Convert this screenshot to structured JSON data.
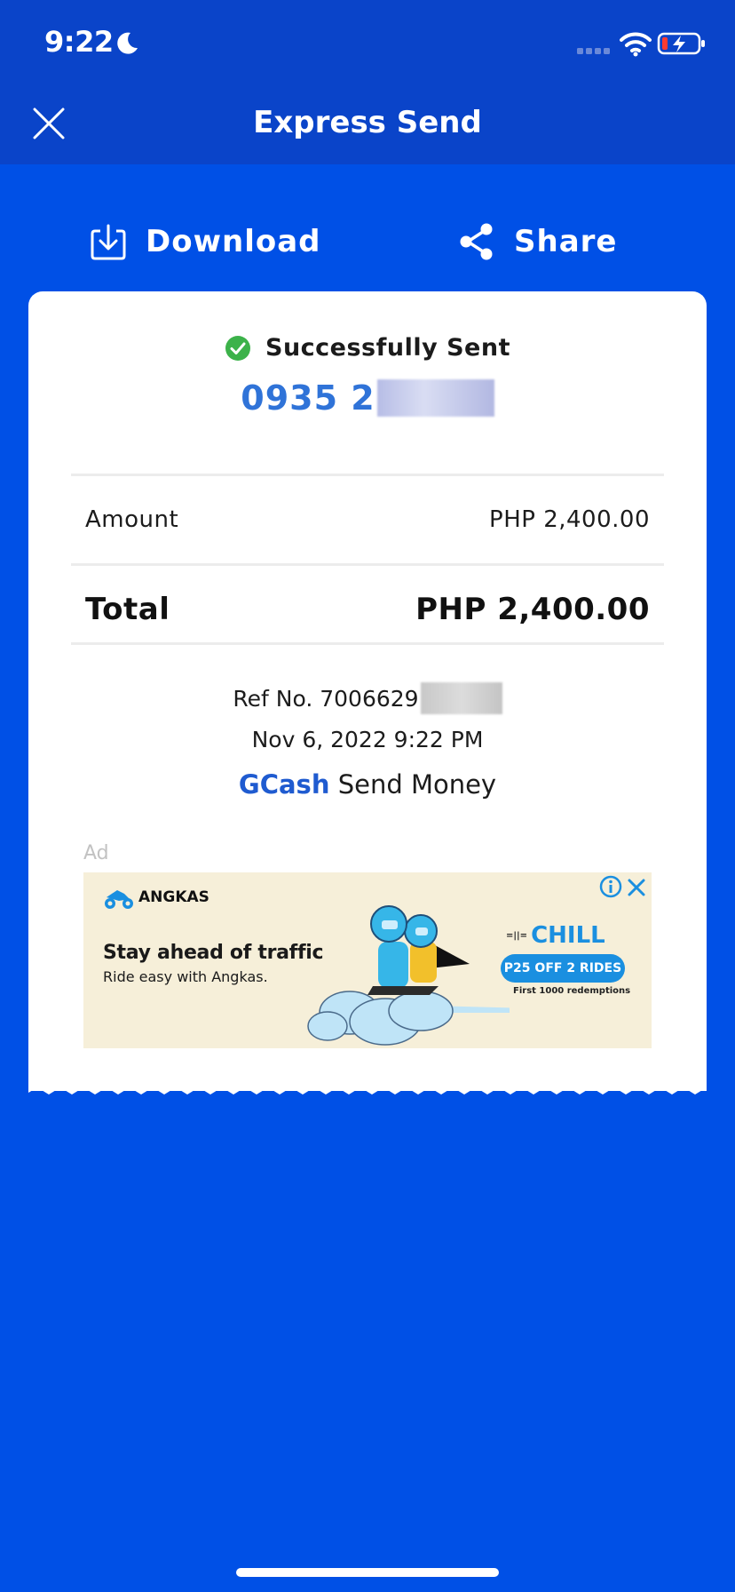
{
  "status_bar": {
    "time": "9:22"
  },
  "header": {
    "title": "Express Send"
  },
  "actions": {
    "download_label": "Download",
    "share_label": "Share"
  },
  "receipt": {
    "status": "Successfully Sent",
    "recipient_number_visible": "0935 2",
    "amount_label": "Amount",
    "amount_value": "PHP 2,400.00",
    "total_label": "Total",
    "total_value": "PHP 2,400.00",
    "ref_text": "Ref No. 7006629",
    "datetime": "Nov 6, 2022 9:22 PM",
    "brand_name": "GCash",
    "service": "Send Money"
  },
  "ad": {
    "label": "Ad",
    "brand": "ANGKAS",
    "headline": "Stay ahead of traffic",
    "subline": "Ride easy with Angkas.",
    "promo_mark": "=||=",
    "promo": "CHILL",
    "pill": "P25 OFF 2 RIDES",
    "fine_print": "First 1000 redemptions"
  },
  "colors": {
    "background": "#0050e6",
    "header_bg": "#0a44c9",
    "accent_blue": "#2f73d8",
    "success_green": "#3cb24a"
  },
  "icons": [
    "moon-icon",
    "signal-icon",
    "wifi-icon",
    "battery-icon",
    "close-icon",
    "download-icon",
    "share-icon",
    "check-icon",
    "info-icon",
    "ad-close-icon"
  ]
}
